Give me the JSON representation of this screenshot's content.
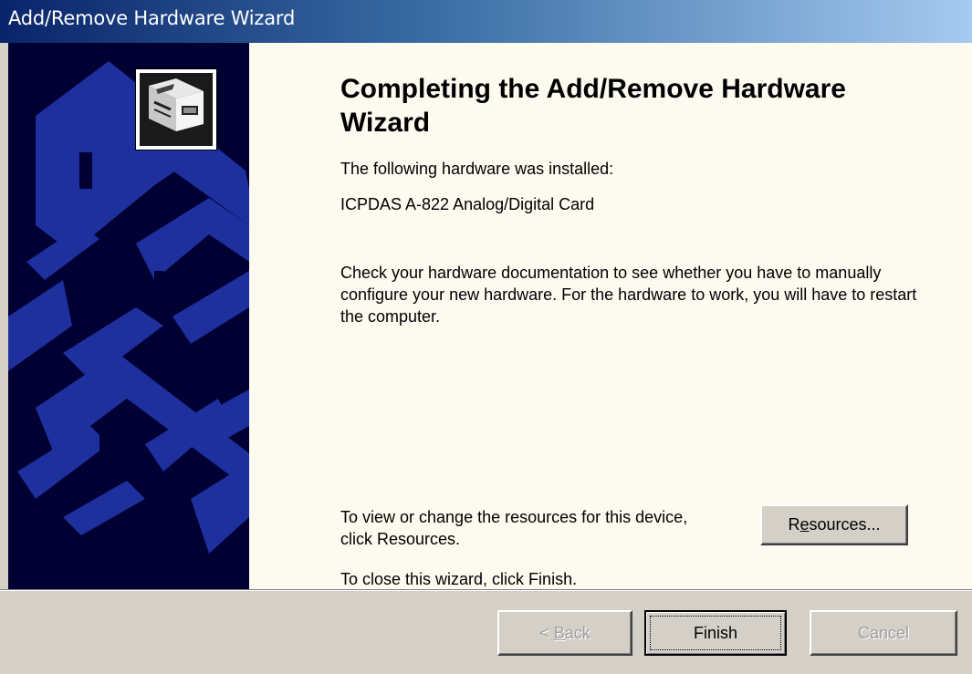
{
  "window": {
    "title": "Add/Remove Hardware Wizard"
  },
  "content": {
    "heading": "Completing the Add/Remove Hardware Wizard",
    "installed_intro": "The following hardware was installed:",
    "device_name": "ICPDAS A-822 Analog/Digital Card",
    "documentation_note": "Check your hardware documentation to see whether you have to manually configure your new hardware. For the hardware to work, you will have to restart the computer.",
    "resources_note": "To view or change the resources for this device, click Resources.",
    "close_note": "To close this wizard, click Finish."
  },
  "buttons": {
    "resources": {
      "label": "Resources...",
      "mnemonic_pre": "R",
      "mnemonic_key": "e",
      "mnemonic_post": "sources..."
    },
    "back": {
      "label": "< Back",
      "mnemonic_pre": "< ",
      "mnemonic_key": "B",
      "mnemonic_post": "ack",
      "enabled": false
    },
    "finish": {
      "label": "Finish",
      "enabled": true,
      "default": true
    },
    "cancel": {
      "label": "Cancel",
      "enabled": false
    }
  },
  "icons": {
    "hardware_icon": "hardware-card-icon",
    "sidebar_art": "wizard-sidebar-graphic"
  },
  "colors": {
    "titlebar_start": "#0a246a",
    "titlebar_end": "#a6caf0",
    "sidebar_bg": "#000033",
    "sidebar_art": "#1e2f9e",
    "content_bg": "#fdfaf0",
    "chrome_bg": "#d4d0c8"
  }
}
